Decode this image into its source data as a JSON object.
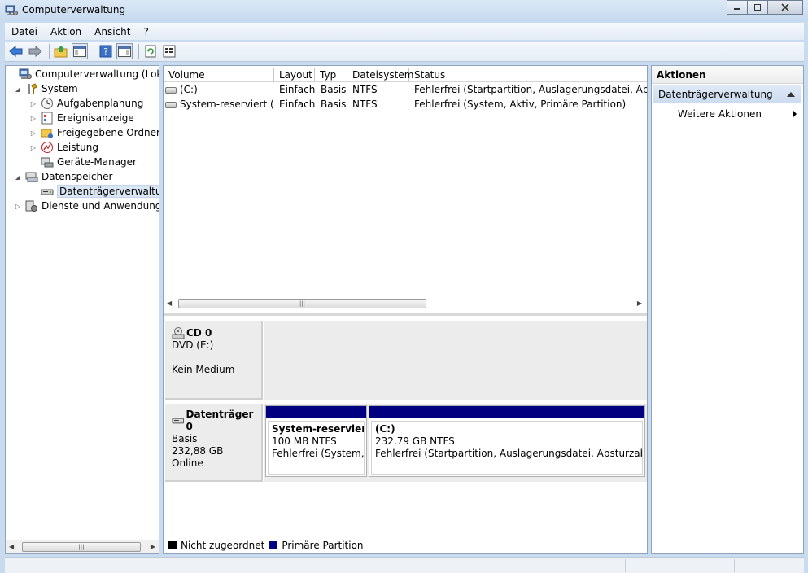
{
  "window": {
    "title": "Computerverwaltung",
    "minimize": "▭",
    "restore": "▣",
    "close": "✕"
  },
  "menu": [
    "Datei",
    "Aktion",
    "Ansicht",
    "?"
  ],
  "toolbar_icons": [
    "back-arrow-icon",
    "forward-arrow-icon",
    "up-folder-icon",
    "show-hide-tree-icon",
    "help-icon",
    "show-hide-action-pane-icon",
    "refresh-icon",
    "properties-icon"
  ],
  "tree": {
    "items": [
      {
        "label": "Computerverwaltung (Lokal)",
        "icon": "computer-management-icon",
        "level": 0,
        "expander": ""
      },
      {
        "label": "System",
        "icon": "system-tools-icon",
        "level": 1,
        "expander": "◢"
      },
      {
        "label": "Aufgabenplanung",
        "icon": "clock-icon",
        "level": 2,
        "expander": "▷"
      },
      {
        "label": "Ereignisanzeige",
        "icon": "event-viewer-icon",
        "level": 2,
        "expander": "▷"
      },
      {
        "label": "Freigegebene Ordner",
        "icon": "shared-folder-icon",
        "level": 2,
        "expander": "▷"
      },
      {
        "label": "Leistung",
        "icon": "performance-icon",
        "level": 2,
        "expander": "▷"
      },
      {
        "label": "Geräte-Manager",
        "icon": "device-manager-icon",
        "level": 2,
        "expander": ""
      },
      {
        "label": "Datenspeicher",
        "icon": "storage-icon",
        "level": 1,
        "expander": "◢"
      },
      {
        "label": "Datenträgerverwaltung",
        "icon": "disk-management-icon",
        "level": 2,
        "expander": "",
        "selected": true
      },
      {
        "label": "Dienste und Anwendungen",
        "icon": "services-icon",
        "level": 1,
        "expander": "▷"
      }
    ],
    "scroll_grip": "|||"
  },
  "volumes": {
    "columns": [
      "Volume",
      "Layout",
      "Typ",
      "Dateisystem",
      "Status"
    ],
    "rows": [
      {
        "volume": "(C:)",
        "layout": "Einfach",
        "typ": "Basis",
        "dateisystem": "NTFS",
        "status": "Fehlerfrei (Startpartition, Auslagerungsdatei, Absturzabbild, Primäre Partition)"
      },
      {
        "volume": "System-reserviert (D:)",
        "layout": "Einfach",
        "typ": "Basis",
        "dateisystem": "NTFS",
        "status": "Fehlerfrei (System, Aktiv, Primäre Partition)"
      }
    ],
    "scroll_grip": "|||"
  },
  "disks": {
    "cd": {
      "name": "CD 0",
      "line1": "DVD (E:)",
      "line2": "Kein Medium"
    },
    "disk0": {
      "name": "Datenträger 0",
      "line1": "Basis",
      "line2": "232,88 GB",
      "line3": "Online",
      "partitions": [
        {
          "name": "System-reserviert  (",
          "size": "100 MB NTFS",
          "status": "Fehlerfrei (System, Aktiv"
        },
        {
          "name": "(C:)",
          "size": "232,79 GB NTFS",
          "status": "Fehlerfrei (Startpartition, Auslagerungsdatei, Absturzabbild, Pr"
        }
      ]
    }
  },
  "legend": [
    {
      "label": "Nicht zugeordnet",
      "color": "#000000"
    },
    {
      "label": "Primäre Partition",
      "color": "#000080"
    }
  ],
  "actions": {
    "title": "Aktionen",
    "section": "Datenträgerverwaltung",
    "item": "Weitere Aktionen"
  }
}
